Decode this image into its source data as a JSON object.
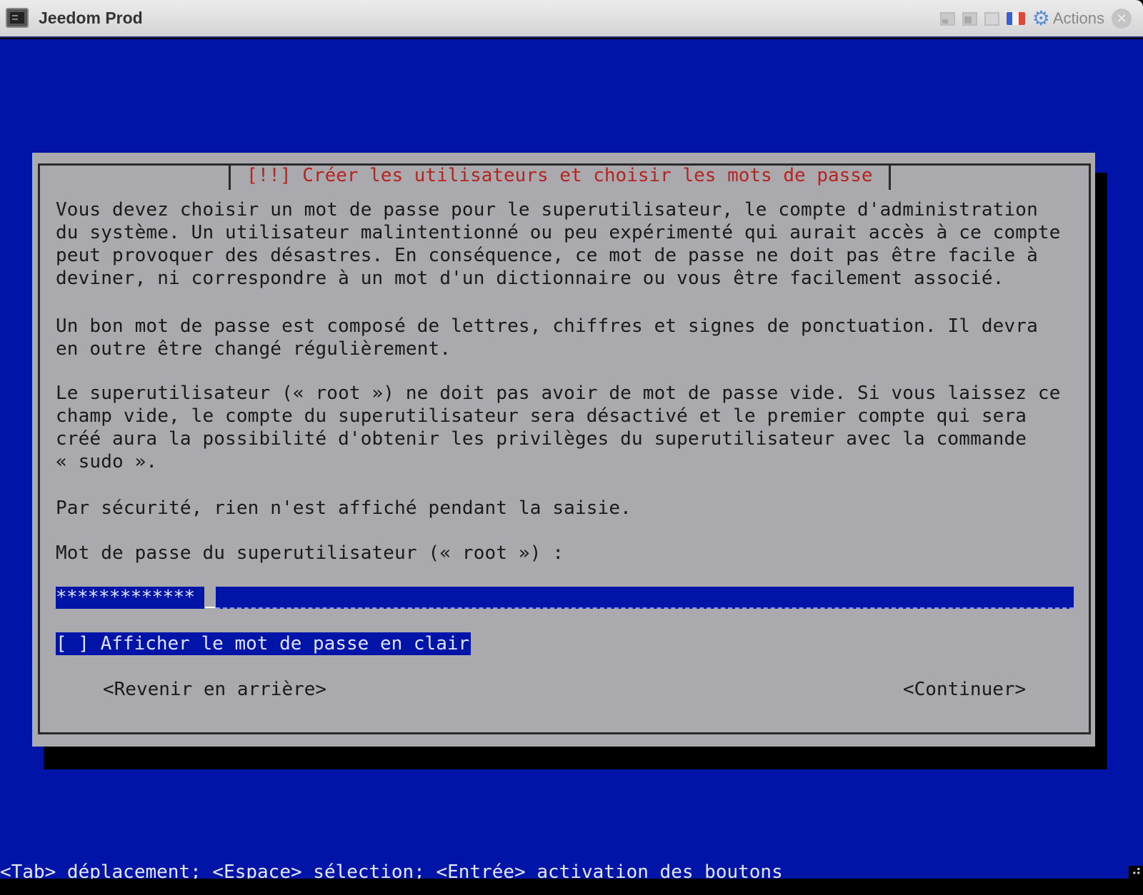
{
  "window": {
    "title": "Jeedom Prod",
    "app_icon": "terminal-icon",
    "controls": {
      "actions_label": "Actions",
      "gear_icon": "⚙",
      "close_icon": "✕",
      "keyboard_layout_flag": "fr",
      "flag_colors": [
        "#3b5fd0",
        "#f2f2f2",
        "#d94a3a"
      ]
    }
  },
  "colors": {
    "screen_bg": "#0015a8",
    "dialog_bg": "#aaa9ad",
    "title_color": "#b52420",
    "selection_bg": "#0015a8"
  },
  "dialog": {
    "title": "[!!] Créer les utilisateurs et choisir les mots de passe",
    "paragraphs": [
      "Vous devez choisir un mot de passe pour le superutilisateur, le compte d'administration\ndu système. Un utilisateur malintentionné ou peu expérimenté qui aurait accès à ce compte\npeut provoquer des désastres. En conséquence, ce mot de passe ne doit pas être facile à\ndeviner, ni correspondre à un mot d'un dictionnaire ou vous être facilement associé.",
      "Un bon mot de passe est composé de lettres, chiffres et signes de ponctuation. Il devra\nen outre être changé régulièrement.",
      "Le superutilisateur (« root ») ne doit pas avoir de mot de passe vide. Si vous laissez ce\nchamp vide, le compte du superutilisateur sera désactivé et le premier compte qui sera\ncréé aura la possibilité d'obtenir les privilèges du superutilisateur avec la commande\n« sudo ».",
      "Par sécurité, rien n'est affiché pendant la saisie."
    ],
    "prompt": "Mot de passe du superutilisateur (« root ») :",
    "password_field": {
      "masked_value": "*************"
    },
    "show_password_checkbox": {
      "label": "[ ] Afficher le mot de passe en clair",
      "checked": false
    },
    "buttons": {
      "back": "<Revenir en arrière>",
      "continue": "<Continuer>"
    }
  },
  "help_line": "<Tab> déplacement; <Espace> sélection; <Entrée> activation des boutons"
}
